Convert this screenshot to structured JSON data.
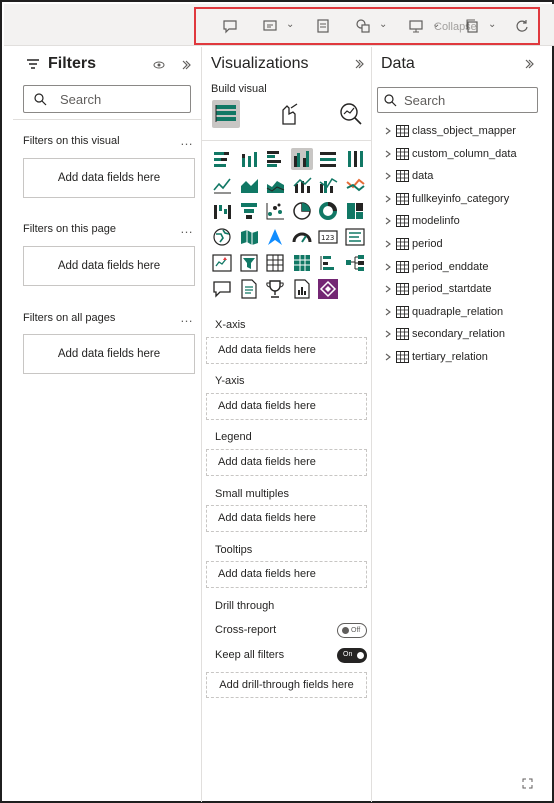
{
  "topbar": {
    "icons": [
      "comment-icon",
      "visual-options-icon",
      "format-icon",
      "shapes-icon",
      "present-icon",
      "copy-icon",
      "refresh-icon"
    ],
    "collapse_label": "Collapse"
  },
  "filters": {
    "title": "Filters",
    "search_placeholder": "Search",
    "sections": [
      {
        "title": "Filters on this visual",
        "add_label": "Add data fields here"
      },
      {
        "title": "Filters on this page",
        "add_label": "Add data fields here"
      },
      {
        "title": "Filters on all pages",
        "add_label": "Add data fields here"
      }
    ]
  },
  "visualizations": {
    "title": "Visualizations",
    "build_visual_label": "Build visual",
    "wells": [
      {
        "title": "X-axis",
        "placeholder": "Add data fields here"
      },
      {
        "title": "Y-axis",
        "placeholder": "Add data fields here"
      },
      {
        "title": "Legend",
        "placeholder": "Add data fields here"
      },
      {
        "title": "Small multiples",
        "placeholder": "Add data fields here"
      },
      {
        "title": "Tooltips",
        "placeholder": "Add data fields here"
      }
    ],
    "drill_through_label": "Drill through",
    "cross_report_label": "Cross-report",
    "cross_report_state": "Off",
    "keep_filters_label": "Keep all filters",
    "keep_filters_state": "On",
    "add_drill_label": "Add drill-through fields here"
  },
  "data": {
    "title": "Data",
    "search_placeholder": "Search",
    "tables": [
      "class_object_mapper",
      "custom_column_data",
      "data",
      "fullkeyinfo_category",
      "modelinfo",
      "period",
      "period_enddate",
      "period_startdate",
      "quadraple_relation",
      "secondary_relation",
      "tertiary_relation"
    ]
  },
  "colors": {
    "highlight": "#e0393e",
    "accent": "#118dff"
  }
}
